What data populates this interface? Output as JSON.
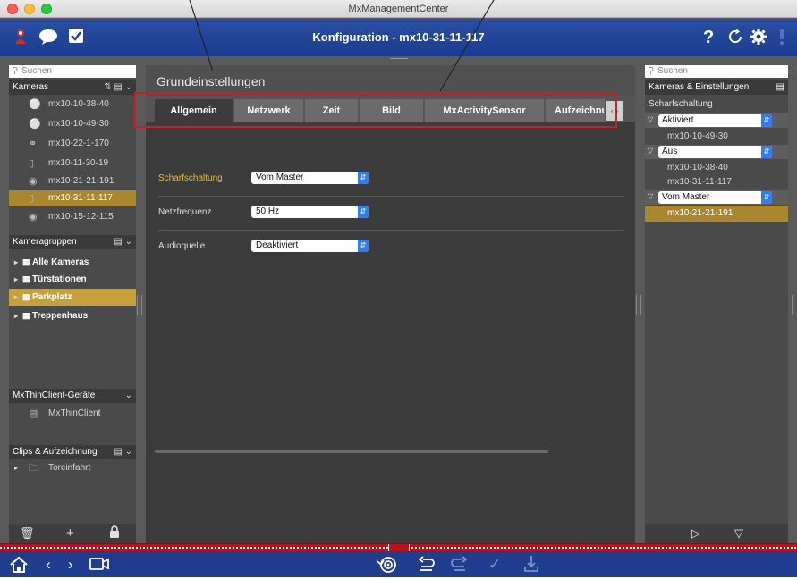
{
  "window": {
    "title": "MxManagementCenter"
  },
  "toolbar": {
    "title": "Konfiguration - mx10-31-11-117",
    "help_glyph": "?",
    "left_icons": [
      "camera-person-icon",
      "chat-icon",
      "checkbox-icon"
    ],
    "right_icons": [
      "help-icon",
      "refresh-icon",
      "gear-icon",
      "alert-icon"
    ]
  },
  "sidebar_left": {
    "search_placeholder": "Suchen",
    "cameras_header": "Kameras",
    "cameras": [
      {
        "label": "mx10-10-38-40",
        "icon": "dome-camera-icon",
        "selected": false
      },
      {
        "label": "mx10-10-49-30",
        "icon": "dome-camera-icon",
        "selected": false
      },
      {
        "label": "mx10-22-1-170",
        "icon": "dual-camera-icon",
        "selected": false
      },
      {
        "label": "mx10-11-30-19",
        "icon": "door-station-icon",
        "selected": false
      },
      {
        "label": "mx10-21-21-191",
        "icon": "hemispheric-camera-icon",
        "selected": false
      },
      {
        "label": "mx10-31-11-117",
        "icon": "door-station-icon",
        "selected": true
      },
      {
        "label": "mx10-15-12-115",
        "icon": "hemispheric-camera-icon",
        "selected": false
      }
    ],
    "groups_header": "Kameragruppen",
    "groups": [
      {
        "label": "Alle Kameras",
        "selected": false
      },
      {
        "label": "Türstationen",
        "selected": false
      },
      {
        "label": "Parkplatz",
        "selected": true
      },
      {
        "label": "Treppenhaus",
        "selected": false
      }
    ],
    "thinclient_header": "MxThinClient-Geräte",
    "thinclients": [
      {
        "label": "MxThinClient"
      }
    ],
    "clips_header": "Clips & Aufzeichnung",
    "clips": [
      {
        "label": "Toreinfahrt"
      }
    ]
  },
  "main": {
    "title": "Grundeinstellungen",
    "tabs": [
      {
        "label": "Allgemein",
        "active": true
      },
      {
        "label": "Netzwerk",
        "active": false
      },
      {
        "label": "Zeit",
        "active": false
      },
      {
        "label": "Bild",
        "active": false
      },
      {
        "label": "MxActivitySensor",
        "active": false
      },
      {
        "label": "Aufzeichnung",
        "active": false
      }
    ],
    "settings": [
      {
        "label": "Scharfschaltung",
        "value": "Vom Master",
        "accent": true
      },
      {
        "label": "Netzfrequenz",
        "value": "50 Hz",
        "accent": false
      },
      {
        "label": "Audioquelle",
        "value": "Deaktiviert",
        "accent": false
      }
    ]
  },
  "sidebar_right": {
    "search_placeholder": "Suchen",
    "header": "Kameras & Einstellungen",
    "setting_label": "Scharfschaltung",
    "groups": [
      {
        "value": "Aktiviert",
        "items": [
          {
            "label": "mx10-10-49-30",
            "selected": false
          }
        ]
      },
      {
        "value": "Aus",
        "items": [
          {
            "label": "mx10-10-38-40",
            "selected": false
          },
          {
            "label": "mx10-31-11-117",
            "selected": false
          }
        ]
      },
      {
        "value": "Vom Master",
        "items": [
          {
            "label": "mx10-21-21-191",
            "selected": true
          }
        ]
      }
    ]
  },
  "colors": {
    "toolbar_blue": "#1f3e8f",
    "selection_gold": "#a8872e",
    "accent_label": "#e8bb38",
    "highlight_red": "#cc1e2a",
    "select_arrow_blue": "#2f7ef6"
  }
}
